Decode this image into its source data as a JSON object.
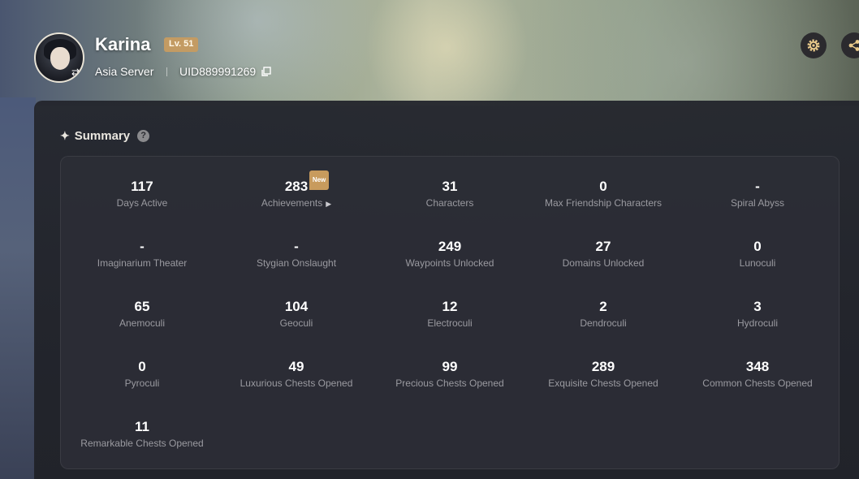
{
  "profile": {
    "nickname": "Karina",
    "level": "Lv. 51",
    "server": "Asia Server",
    "uid": "UID889991269"
  },
  "summary": {
    "title": "Summary",
    "help_icon": "question-circle-icon"
  },
  "stats": [
    {
      "value": "117",
      "label": "Days Active"
    },
    {
      "value": "283",
      "label": "Achievements",
      "badge": "New",
      "has_chevron": true
    },
    {
      "value": "31",
      "label": "Characters"
    },
    {
      "value": "0",
      "label": "Max Friendship Characters"
    },
    {
      "value": "-",
      "label": "Spiral Abyss"
    },
    {
      "value": "-",
      "label": "Imaginarium Theater"
    },
    {
      "value": "-",
      "label": "Stygian Onslaught"
    },
    {
      "value": "249",
      "label": "Waypoints Unlocked"
    },
    {
      "value": "27",
      "label": "Domains Unlocked"
    },
    {
      "value": "0",
      "label": "Lunoculi"
    },
    {
      "value": "65",
      "label": "Anemoculi"
    },
    {
      "value": "104",
      "label": "Geoculi"
    },
    {
      "value": "12",
      "label": "Electroculi"
    },
    {
      "value": "2",
      "label": "Dendroculi"
    },
    {
      "value": "3",
      "label": "Hydroculi"
    },
    {
      "value": "0",
      "label": "Pyroculi"
    },
    {
      "value": "49",
      "label": "Luxurious Chests Opened"
    },
    {
      "value": "99",
      "label": "Precious Chests Opened"
    },
    {
      "value": "289",
      "label": "Exquisite Chests Opened"
    },
    {
      "value": "348",
      "label": "Common Chests Opened"
    },
    {
      "value": "11",
      "label": "Remarkable Chests Opened"
    }
  ],
  "colors": {
    "level_badge": "#c39b63",
    "new_badge": "#c89b5d",
    "panel": "#24262d"
  }
}
